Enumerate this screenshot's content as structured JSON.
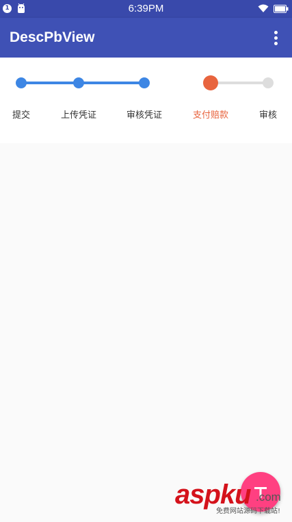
{
  "status_bar": {
    "notification_count": "1",
    "time": "6:39PM",
    "icons": [
      "notification-badge-icon",
      "android-icon",
      "wifi-icon",
      "battery-icon"
    ]
  },
  "app_bar": {
    "title": "DescPbView",
    "menu_icon": "more-vert-icon"
  },
  "steps": {
    "items": [
      {
        "label": "提交",
        "state": "done"
      },
      {
        "label": "上传凭证",
        "state": "done"
      },
      {
        "label": "审核凭证",
        "state": "done"
      },
      {
        "label": "支付赔款",
        "state": "current"
      },
      {
        "label": "审核",
        "state": "pending"
      }
    ],
    "colors": {
      "done": "#3d86e4",
      "current": "#e8643e",
      "pending": "#dddddd"
    }
  },
  "fab": {
    "icon": "fab-icon",
    "color": "#ff4081"
  },
  "watermark": {
    "main": "aspku",
    "suffix": ".com",
    "sub": "免费网站源码下载站!"
  }
}
